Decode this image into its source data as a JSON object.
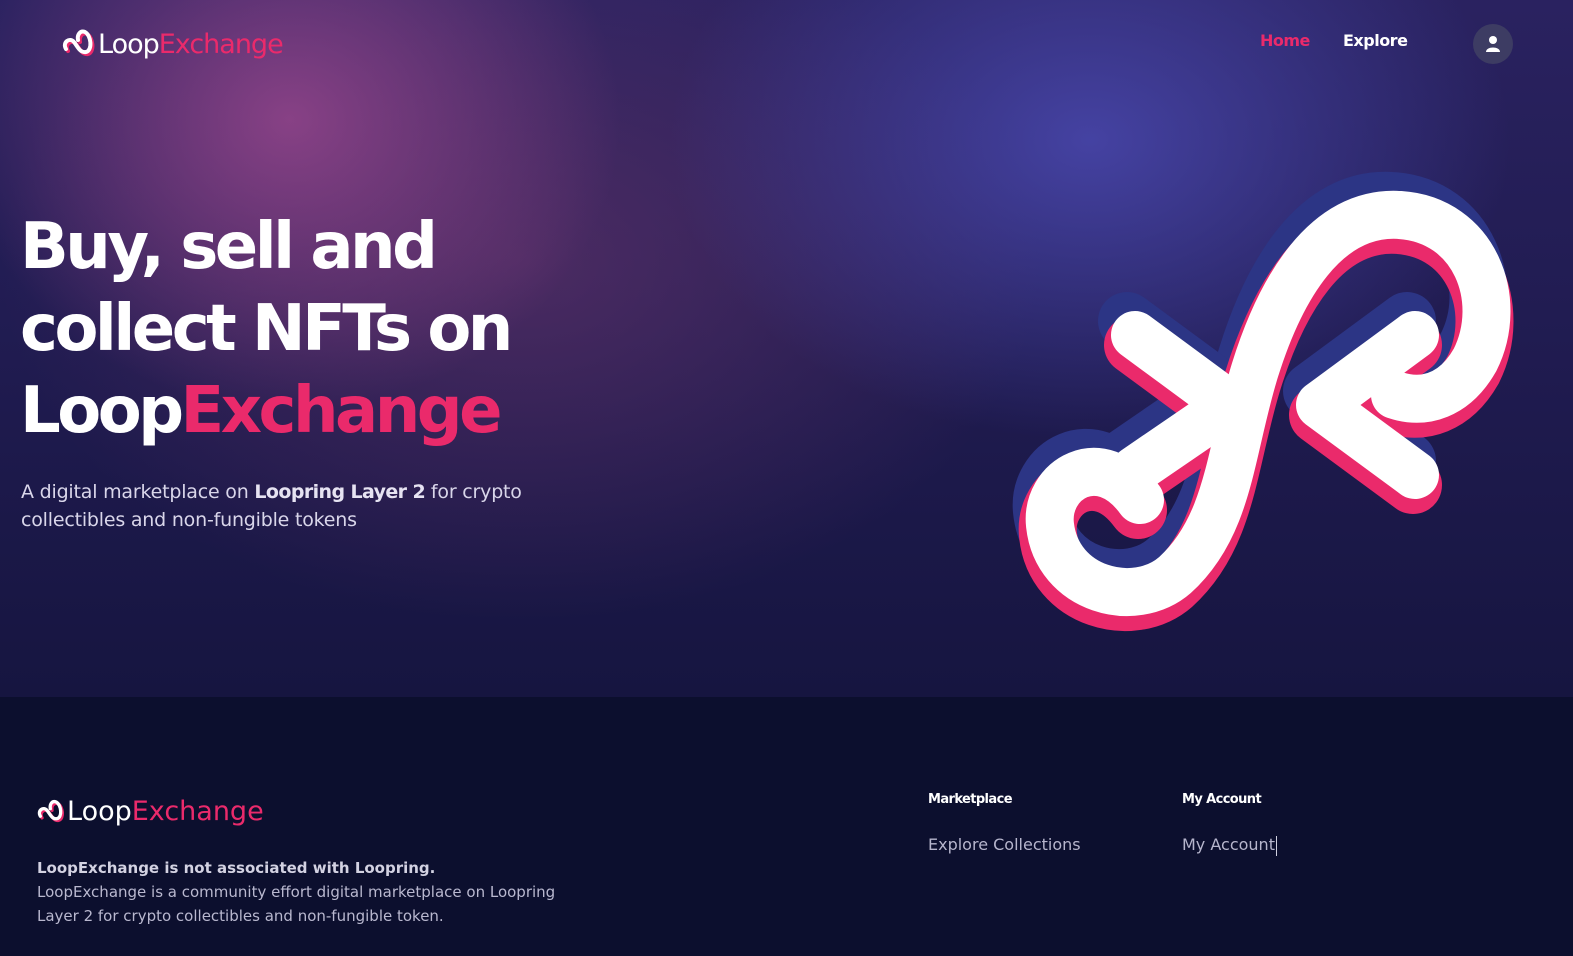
{
  "brand": {
    "part1": "Loop",
    "part2": "Exchange"
  },
  "nav": {
    "home": "Home",
    "explore": "Explore",
    "account_icon": "user-icon"
  },
  "hero": {
    "line1": "Buy, sell and",
    "line2": "collect NFTs on",
    "line3_part1": "Loop",
    "line3_part2": "Exchange",
    "subtitle_pre": "A digital marketplace on ",
    "subtitle_bold": "Loopring Layer 2",
    "subtitle_post": " for crypto collectibles and non-fungible tokens"
  },
  "footer": {
    "disclaimer_bold": "LoopExchange is not associated with Loopring.",
    "disclaimer_text": "LoopExchange is a community effort digital marketplace on Loopring Layer 2 for crypto collectibles and non-fungible token.",
    "marketplace": {
      "heading": "Marketplace",
      "links": [
        "Explore Collections"
      ]
    },
    "account": {
      "heading": "My Account",
      "links": [
        "My Account"
      ]
    }
  },
  "colors": {
    "accent": "#ea2a6b",
    "navy": "#2c3585",
    "background": "#0c0f2e"
  }
}
